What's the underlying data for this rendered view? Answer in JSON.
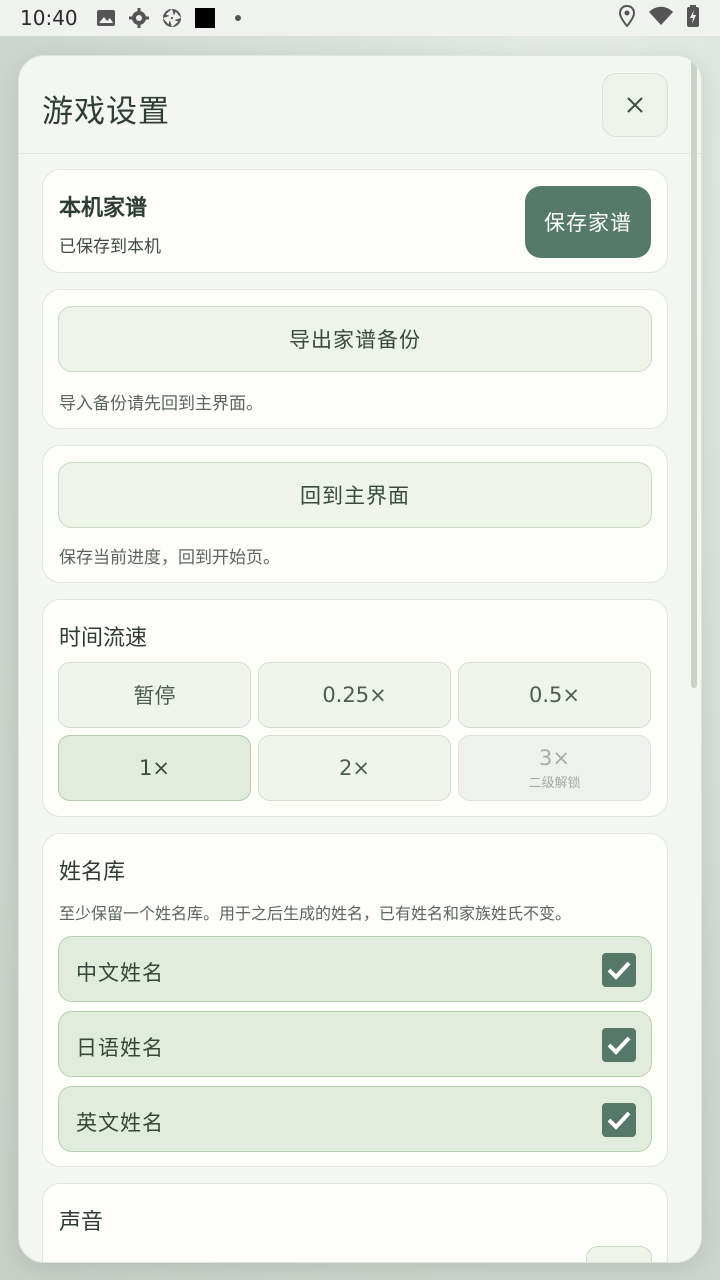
{
  "status_bar": {
    "time": "10:40",
    "icons": [
      "image-icon",
      "gear-icon",
      "aperture-icon",
      "black-square-icon",
      "dot-icon"
    ],
    "right_icons": [
      "location-icon",
      "wifi-icon",
      "battery-charging-icon"
    ]
  },
  "dialog": {
    "title": "游戏设置",
    "close_icon": "close-icon"
  },
  "local_family": {
    "title": "本机家谱",
    "status": "已保存到本机",
    "save_label": "保存家谱"
  },
  "export": {
    "button_label": "导出家谱备份",
    "note": "导入备份请先回到主界面。"
  },
  "home": {
    "button_label": "回到主界面",
    "note": "保存当前进度，回到开始页。"
  },
  "time_speed": {
    "title": "时间流速",
    "options": [
      {
        "label": "暂停",
        "state": "normal"
      },
      {
        "label": "0.25×",
        "state": "normal"
      },
      {
        "label": "0.5×",
        "state": "normal"
      },
      {
        "label": "1×",
        "state": "selected"
      },
      {
        "label": "2×",
        "state": "normal"
      },
      {
        "label": "3×",
        "sub": "二级解锁",
        "state": "locked"
      }
    ]
  },
  "name_library": {
    "title": "姓名库",
    "note": "至少保留一个姓名库。用于之后生成的姓名，已有姓名和家族姓氏不变。",
    "items": [
      {
        "label": "中文姓名",
        "checked": true
      },
      {
        "label": "日语姓名",
        "checked": true
      },
      {
        "label": "英文姓名",
        "checked": true
      }
    ]
  },
  "sound": {
    "title": "声音"
  },
  "colors": {
    "accent": "#567a6a",
    "card_bg": "#fdfdf9",
    "selected_bg": "#e1ecdb"
  }
}
